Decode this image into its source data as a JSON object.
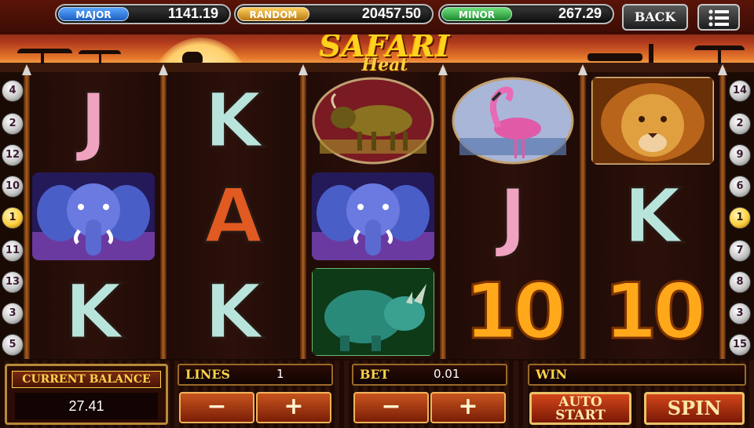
{
  "jackpots": [
    {
      "label": "MAJOR",
      "value": "1141.19",
      "color": "#2f7fe0"
    },
    {
      "label": "RANDOM",
      "value": "20457.50",
      "color": "#e0a020"
    },
    {
      "label": "MINOR",
      "value": "267.29",
      "color": "#2fa84a"
    }
  ],
  "nav": {
    "back_label": "BACK",
    "menu_icon": "menu-icon"
  },
  "logo": {
    "main": "SAFARI",
    "sub": "Heat"
  },
  "reels": [
    [
      "J",
      "elephant",
      "K"
    ],
    [
      "K",
      "A",
      "K"
    ],
    [
      "wildebeest",
      "elephant",
      "rhino"
    ],
    [
      "flamingo",
      "J",
      "10"
    ],
    [
      "lion",
      "K",
      "10"
    ]
  ],
  "line_markers": {
    "left": [
      "4",
      "2",
      "12",
      "10",
      "1",
      "11",
      "13",
      "3",
      "5"
    ],
    "right": [
      "14",
      "2",
      "9",
      "6",
      "1",
      "7",
      "8",
      "3",
      "15"
    ],
    "active": "1"
  },
  "balance": {
    "label": "CURRENT BALANCE",
    "value": "27.41"
  },
  "lines": {
    "label": "LINES",
    "value": "1",
    "minus": "−",
    "plus": "+"
  },
  "bet": {
    "label": "BET",
    "value": "0.01",
    "minus": "−",
    "plus": "+"
  },
  "win": {
    "label": "WIN",
    "value": ""
  },
  "buttons": {
    "auto_start_1": "AUTO",
    "auto_start_2": "START",
    "spin": "SPIN"
  }
}
